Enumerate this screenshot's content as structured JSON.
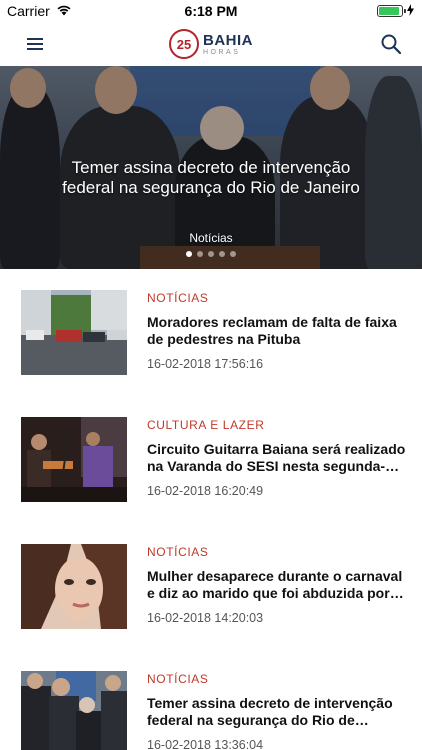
{
  "status_bar": {
    "carrier": "Carrier",
    "time": "6:18 PM",
    "battery_level": 0.9,
    "battery_color": "#35c759"
  },
  "nav": {
    "menu_icon": "hamburger-menu-icon",
    "search_icon": "search-icon",
    "logo": {
      "number": "25",
      "name": "BAHIA",
      "subtitle": "HORAS"
    },
    "brand_colors": {
      "red": "#b3242b",
      "navy": "#1f3355"
    }
  },
  "hero": {
    "title": "Temer assina decreto de intervenção federal na segurança do Rio de Janeiro",
    "category": "Notícias",
    "dot_count": 5,
    "active_dot": 0
  },
  "articles": [
    {
      "category": "NOTÍCIAS",
      "title": "Moradores reclamam de falta de faixa de pedestres na Pituba",
      "date": "16-02-2018 17:56:16"
    },
    {
      "category": "CULTURA E LAZER",
      "title": "Circuito Guitarra Baiana será realizado na Varanda do SESI nesta segunda-feira",
      "date": "16-02-2018 16:20:49"
    },
    {
      "category": "NOTÍCIAS",
      "title": "Mulher desaparece durante o carnaval e diz ao marido que foi abduzida por extraterrestres",
      "date": "16-02-2018 14:20:03"
    },
    {
      "category": "NOTÍCIAS",
      "title": "Temer assina decreto de intervenção federal na segurança do Rio de Janeiro",
      "date": "16-02-2018 13:36:04"
    }
  ],
  "accent_color": "#c0392b"
}
